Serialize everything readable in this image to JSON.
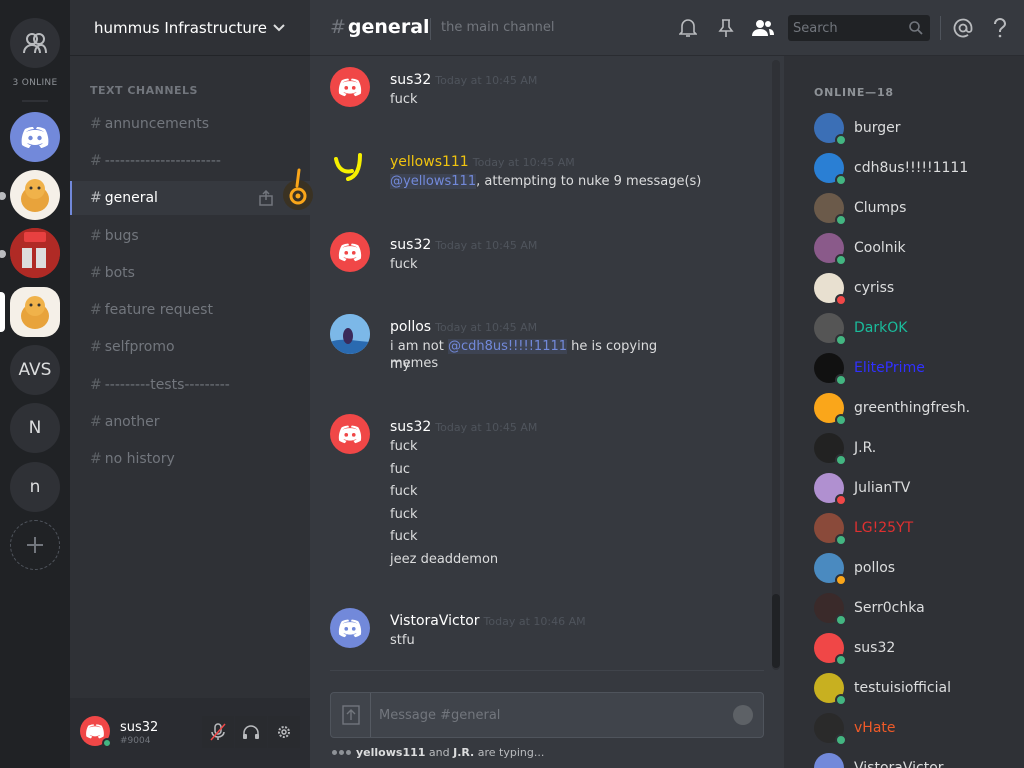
{
  "rail": {
    "online_label": "3 ONLINE",
    "servers": [
      {
        "label": "",
        "icon": "discord-logo",
        "color": "#7289da"
      },
      {
        "label": "",
        "icon": "cat-statue",
        "color": "#e8a33b"
      },
      {
        "label": "",
        "icon": "youtube-photo",
        "color": "#c0302b"
      },
      {
        "label": "",
        "icon": "cat-statue",
        "color": "#e8a33b"
      },
      {
        "label": "AVS"
      },
      {
        "label": "N"
      },
      {
        "label": "n"
      }
    ]
  },
  "guild": {
    "name": "hummus Infrastructure",
    "category": "TEXT CHANNELS",
    "channels": [
      {
        "name": "annuncements"
      },
      {
        "name": "-----------------------"
      },
      {
        "name": "general",
        "active": true
      },
      {
        "name": "bugs"
      },
      {
        "name": "bots"
      },
      {
        "name": "feature request"
      },
      {
        "name": "selfpromo"
      },
      {
        "name": "---------tests---------"
      },
      {
        "name": "another"
      },
      {
        "name": "no history"
      }
    ]
  },
  "user_panel": {
    "name": "sus32",
    "tag": "#9004"
  },
  "topbar": {
    "channel": "general",
    "hash": "#",
    "topic": "the main channel",
    "search_placeholder": "Search"
  },
  "messages": [
    {
      "author": "sus32",
      "author_color": "#ffffff",
      "time": "Today at 10:45 AM",
      "avatar": "discord-red",
      "lines": [
        "fuck"
      ]
    },
    {
      "author": "yellows111",
      "author_color": "#f1c40f",
      "time": "Today at 10:45 AM",
      "avatar": "yellow-y",
      "mention": "@yellows111",
      "lines": [
        ", attempting to nuke 9 message(s)"
      ]
    },
    {
      "author": "sus32",
      "author_color": "#ffffff",
      "time": "Today at 10:45 AM",
      "avatar": "discord-red",
      "lines": [
        "fuck"
      ]
    },
    {
      "author": "pollos",
      "author_color": "#ffffff",
      "time": "Today at 10:45 AM",
      "avatar": "pollos-photo",
      "pre": "i am not ",
      "mention": "@cdh8us!!!!!1111",
      "post": " he is copying my",
      "lines": [
        "memes"
      ]
    },
    {
      "author": "sus32",
      "author_color": "#ffffff",
      "time": "Today at 10:45 AM",
      "avatar": "discord-red",
      "lines": [
        "fuck",
        "fuc",
        "fuck",
        "fuck",
        "fuck",
        "jeez deaddemon"
      ]
    },
    {
      "author": "VistoraVictor",
      "author_color": "#ffffff",
      "time": "Today at 10:46 AM",
      "avatar": "discord-blurple",
      "lines": [
        "stfu"
      ]
    }
  ],
  "composer": {
    "placeholder": "Message #general",
    "typing_user1": "yellows111",
    "typing_and": " and ",
    "typing_user2": "J.R.",
    "typing_suffix": " are typing..."
  },
  "members": {
    "header": "ONLINE—18",
    "list": [
      {
        "name": "burger",
        "name_color": "#dcddde",
        "status": "#43b581",
        "avatar_color": "#3b6fb6"
      },
      {
        "name": "cdh8us!!!!!1111",
        "name_color": "#dcddde",
        "status": "#43b581",
        "avatar_color": "#2a7fd4"
      },
      {
        "name": "Clumps",
        "name_color": "#dcddde",
        "status": "#43b581",
        "avatar_color": "#6b5a4a"
      },
      {
        "name": "Coolnik",
        "name_color": "#dcddde",
        "status": "#43b581",
        "avatar_color": "#8a5a8a"
      },
      {
        "name": "cyriss",
        "name_color": "#dcddde",
        "status": "#f04747",
        "avatar_color": "#e8e0d0"
      },
      {
        "name": "DarkOK",
        "name_color": "#1abc9c",
        "status": "#43b581",
        "avatar_color": "#555555"
      },
      {
        "name": "ElitePrime",
        "name_color": "#3030ff",
        "status": "#43b581",
        "avatar_color": "#111111"
      },
      {
        "name": "greenthingfresh.",
        "name_color": "#dcddde",
        "status": "#43b581",
        "avatar_color": "#faa61a"
      },
      {
        "name": "J.R.",
        "name_color": "#dcddde",
        "status": "#43b581",
        "avatar_color": "#222222"
      },
      {
        "name": "JulianTV",
        "name_color": "#dcddde",
        "status": "#f04747",
        "avatar_color": "#b090d0"
      },
      {
        "name": "LG!25YT",
        "name_color": "#e03030",
        "status": "#43b581",
        "avatar_color": "#8a4a3a"
      },
      {
        "name": "pollos",
        "name_color": "#dcddde",
        "status": "#faa61a",
        "avatar_color": "#4a8ac0"
      },
      {
        "name": "Serr0chka",
        "name_color": "#dcddde",
        "status": "#43b581",
        "avatar_color": "#3a2a2a"
      },
      {
        "name": "sus32",
        "name_color": "#dcddde",
        "status": "#43b581",
        "avatar_color": "#f04747"
      },
      {
        "name": "testuisiofficial",
        "name_color": "#dcddde",
        "status": "#43b581",
        "avatar_color": "#c8b020"
      },
      {
        "name": "vHate",
        "name_color": "#f05a28",
        "status": "#43b581",
        "avatar_color": "#2a2a2a"
      },
      {
        "name": "VistoraVictor",
        "name_color": "#dcddde",
        "status": "#43b581",
        "avatar_color": "#7289da"
      }
    ]
  }
}
